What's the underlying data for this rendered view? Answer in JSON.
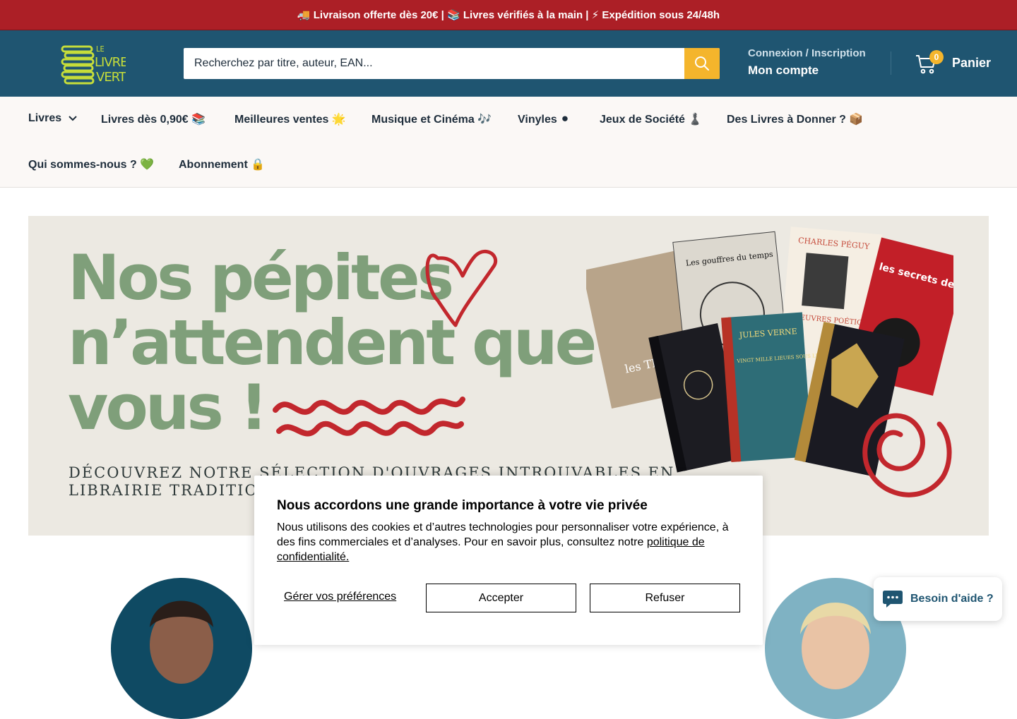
{
  "announcement": {
    "text": "🚚 Livraison offerte dès 20€ | 📚 Livres vérifiés à la main | ⚡ Expédition sous 24/48h"
  },
  "header": {
    "logo": {
      "line1": "LE",
      "line2": "LIVRE",
      "line3": "VERT"
    },
    "search": {
      "placeholder": "Recherchez par titre, auteur, EAN...",
      "icon": "search-icon"
    },
    "account": {
      "top": "Connexion / Inscription",
      "main": "Mon compte"
    },
    "cart": {
      "count": "0",
      "label": "Panier",
      "icon": "cart-icon"
    }
  },
  "nav": {
    "items": [
      {
        "label": "Livres",
        "has_dropdown": true
      },
      {
        "label": "Livres dès 0,90€ 📚"
      },
      {
        "label": "Meilleures ventes 🌟"
      },
      {
        "label": "Musique et Cinéma 🎶"
      },
      {
        "label": "Vinyles ⚫"
      },
      {
        "label": "Jeux de Société ♟️"
      },
      {
        "label": "Des Livres à Donner ? 📦"
      },
      {
        "label": "Qui sommes-nous ? 💚"
      },
      {
        "label": "Abonnement 🔒"
      }
    ]
  },
  "banner": {
    "headline": [
      "Nos pépites",
      "n’attendent que",
      "vous !"
    ],
    "subtitle_line1": "DÉCOUVREZ NOTRE SÉLECTION D'OUVRAGES INTROUVABLES EN",
    "subtitle_line2": "LIBRAIRIE TRADITIONNELLE",
    "book_titles": [
      "les TRÉSORS RETROUVÉS",
      "Les gouffres du temps",
      "CHARLES PÉGUY",
      "ŒUVRES POÉTIQUES",
      "les secrets de l'aura",
      "JULES VERNE",
      "VINGT MILLE LIEUES SOUS LES MERS"
    ]
  },
  "cookie": {
    "title": "Nous accordons une grande importance à votre vie privée",
    "text": "Nous utilisons des cookies et d’autres technologies pour personnaliser votre expérience, à des fins commerciales et d’analyses. Pour en savoir plus, consultez notre",
    "link": "politique de confidentialité.",
    "manage": "Gérer vos préférences",
    "accept": "Accepter",
    "refuse": "Refuser"
  },
  "chat": {
    "label": "Besoin d'aide ?",
    "icon": "chat-icon"
  },
  "colors": {
    "announcement_bg": "#ac1f26",
    "header_bg": "#1f5571",
    "accent": "#f4b52c",
    "nav_bg": "#fbf8f6",
    "headline_green": "#7f9f7a",
    "logo_green": "#c6dd3a"
  }
}
